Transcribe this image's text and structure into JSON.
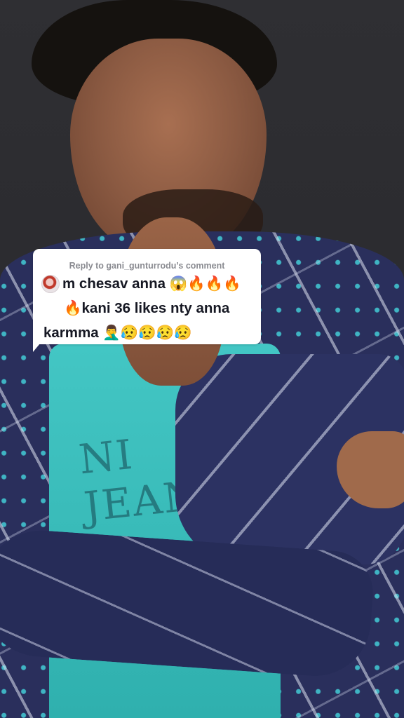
{
  "reply_sticker": {
    "header": "Reply to gani_gunturrodu’s comment",
    "comment_line1": "m chesav anna 😱🔥🔥🔥",
    "comment_line2": "🔥kani 36 likes nty anna",
    "comment_line3": "karmma 🤦‍♂️😥😥😥😥"
  },
  "video": {
    "shirt_print": "NI JEANS"
  },
  "colors": {
    "bubble_bg": "#ffffff",
    "header_text": "#8a8b91",
    "comment_text": "#161823"
  }
}
